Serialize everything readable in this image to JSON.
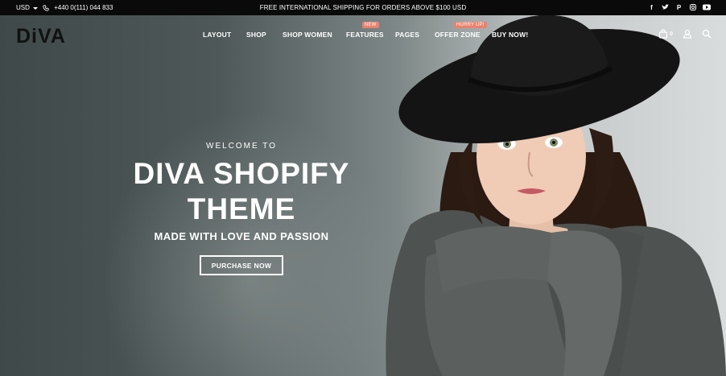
{
  "topbar": {
    "currency": "USD",
    "phone": "+440 0(111) 044 833",
    "announcement": "FREE INTERNATIONAL SHIPPING FOR ORDERS ABOVE $100 USD",
    "social": [
      "f",
      "t",
      "p",
      "ig",
      "yt"
    ]
  },
  "header": {
    "logo": "DiVA",
    "nav": [
      {
        "label": "LAYOUT"
      },
      {
        "label": "SHOP"
      },
      {
        "label": "SHOP WOMEN"
      },
      {
        "label": "FEATURES",
        "badge": "NEW"
      },
      {
        "label": "PAGES"
      },
      {
        "label": "OFFER ZONE",
        "badge": "HURRY UP!"
      },
      {
        "label": "BUY NOW!"
      }
    ],
    "cart_count": "0",
    "icons": [
      "bag-icon",
      "user-icon",
      "search-icon"
    ]
  },
  "hero": {
    "welcome": "WELCOME TO",
    "title_line1": "DIVA SHOPIFY",
    "title_line2": "THEME",
    "subtitle": "MADE WITH LOVE AND PASSION",
    "cta": "PURCHASE NOW"
  },
  "colors": {
    "topbar_bg": "#0a0a0a",
    "badge": "#e8826e",
    "logo_accent": "#e4563f"
  }
}
